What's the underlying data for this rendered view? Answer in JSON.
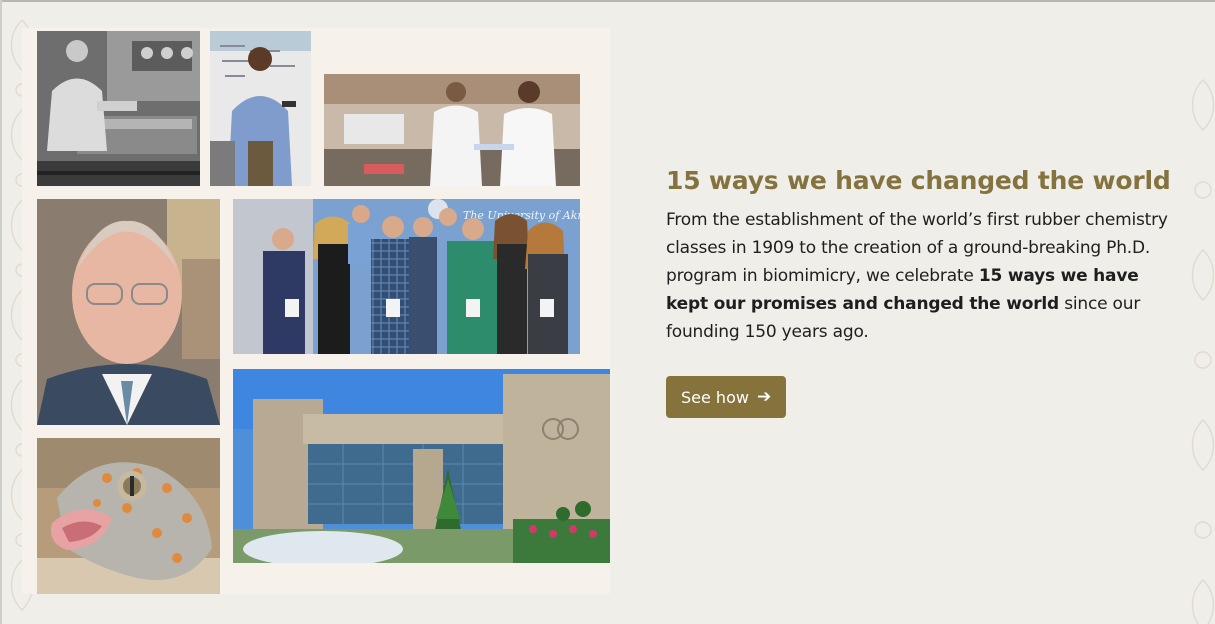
{
  "feature": {
    "headline": "15 ways we have changed the world",
    "body_intro": "From the establishment of the world’s first rubber chemistry classes in 1909 to the creation of a ground-breaking Ph.D. program in biomimicry, we celebrate ",
    "body_bold": "15 ways we have kept our promises and changed the world",
    "body_outro": " since our founding 150 years ago.",
    "cta_label": "See how",
    "cta_icon": "arrow-right-icon"
  },
  "collage": {
    "banner_text": "The University of Akron"
  },
  "colors": {
    "accent": "#85733b",
    "headline": "#84723f",
    "background": "#efeee9",
    "collage_background": "#f6f1eb"
  }
}
